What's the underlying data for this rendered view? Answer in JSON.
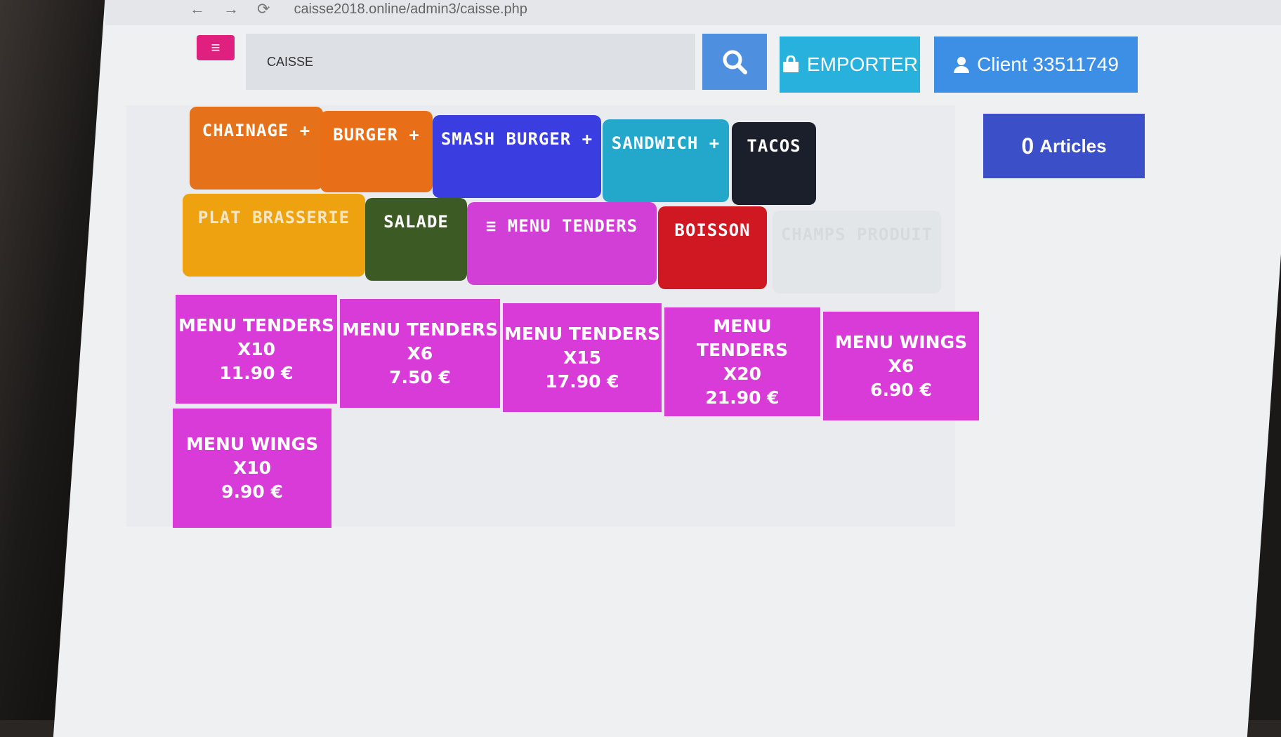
{
  "browser": {
    "url": "caisse2018.online/admin3/caisse.php",
    "back_icon": "←",
    "forward_icon": "→",
    "reload_icon": "⟳"
  },
  "toolbar": {
    "menu_icon": "≡",
    "search_label": "CAISSE",
    "emporter_label": "EMPORTER",
    "client_label": "Client 33511749"
  },
  "categories": [
    {
      "label": "CHAINAGE +",
      "color": "#e5711a"
    },
    {
      "label": "BURGER +",
      "color": "#e86e17"
    },
    {
      "label": "SMASH BURGER +",
      "color": "#3a3ee0"
    },
    {
      "label": "SANDWICH +",
      "color": "#23a8cc"
    },
    {
      "label": "TACOS",
      "color": "#1b1f2b"
    },
    {
      "label": "PLAT BRASSERIE",
      "color": "#eea20f"
    },
    {
      "label": "SALADE",
      "color": "#3c5a24"
    },
    {
      "label": "≡  MENU TENDERS",
      "color": "#d23fd6"
    },
    {
      "label": "BOISSON",
      "color": "#d01822"
    },
    {
      "label": "CHAMPS PRODUIT",
      "color": "#e3e6e9"
    }
  ],
  "products": [
    {
      "name": "MENU TENDERS",
      "qty": "X10",
      "price": "11.90 €"
    },
    {
      "name": "MENU TENDERS",
      "qty": "X6",
      "price": "7.50 €"
    },
    {
      "name": "MENU TENDERS",
      "qty": "X15",
      "price": "17.90 €"
    },
    {
      "name": "MENU TENDERS",
      "qty": "X20",
      "price": "21.90 €"
    },
    {
      "name": "MENU WINGS",
      "qty": "X6",
      "price": "6.90 €"
    },
    {
      "name": "MENU WINGS",
      "qty": "X10",
      "price": "9.90 €"
    }
  ],
  "cart": {
    "count": "0",
    "label": "Articles"
  },
  "colors": {
    "accent_pink": "#e0207f",
    "tile": "#d83bd8",
    "articles": "#3a4fc8"
  }
}
